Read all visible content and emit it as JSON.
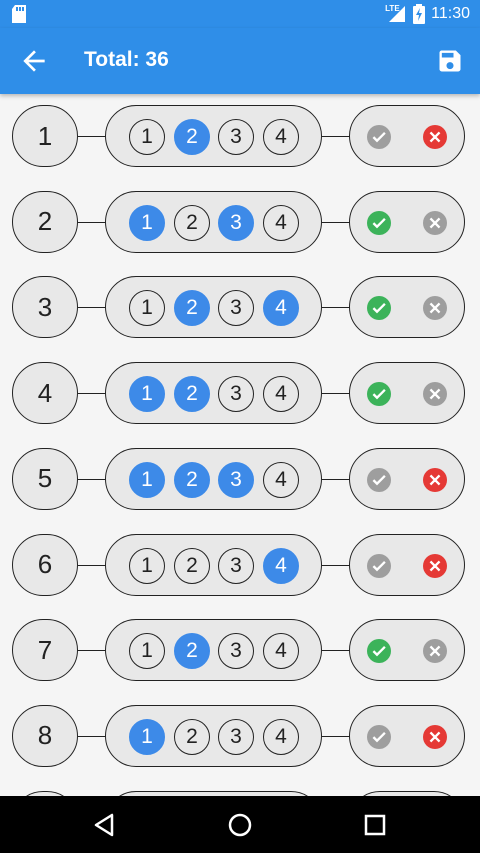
{
  "status_bar": {
    "network": "LTE",
    "time": "11:30",
    "icons": [
      "sd-card-icon",
      "lte-signal-icon",
      "battery-charging-icon"
    ]
  },
  "app_bar": {
    "title": "Total: 36",
    "back_icon": "arrow-back-icon",
    "save_icon": "save-icon"
  },
  "colors": {
    "primary": "#2f8ee8",
    "selected": "#3d8ae8",
    "ok_active": "#3cb35a",
    "x_active": "#e53935",
    "inactive": "#9e9e9e",
    "pill_bg": "#e8e8e8"
  },
  "option_labels": [
    "1",
    "2",
    "3",
    "4"
  ],
  "rows": [
    {
      "number": "1",
      "selected": [
        false,
        true,
        false,
        false
      ],
      "status": "x"
    },
    {
      "number": "2",
      "selected": [
        true,
        false,
        true,
        false
      ],
      "status": "ok"
    },
    {
      "number": "3",
      "selected": [
        false,
        true,
        false,
        true
      ],
      "status": "ok"
    },
    {
      "number": "4",
      "selected": [
        true,
        true,
        false,
        false
      ],
      "status": "ok"
    },
    {
      "number": "5",
      "selected": [
        true,
        true,
        true,
        false
      ],
      "status": "x"
    },
    {
      "number": "6",
      "selected": [
        false,
        false,
        false,
        true
      ],
      "status": "x"
    },
    {
      "number": "7",
      "selected": [
        false,
        true,
        false,
        false
      ],
      "status": "ok"
    },
    {
      "number": "8",
      "selected": [
        true,
        false,
        false,
        false
      ],
      "status": "x"
    }
  ],
  "nav_bar": {
    "icons": [
      "nav-back-icon",
      "nav-home-icon",
      "nav-recents-icon"
    ]
  }
}
